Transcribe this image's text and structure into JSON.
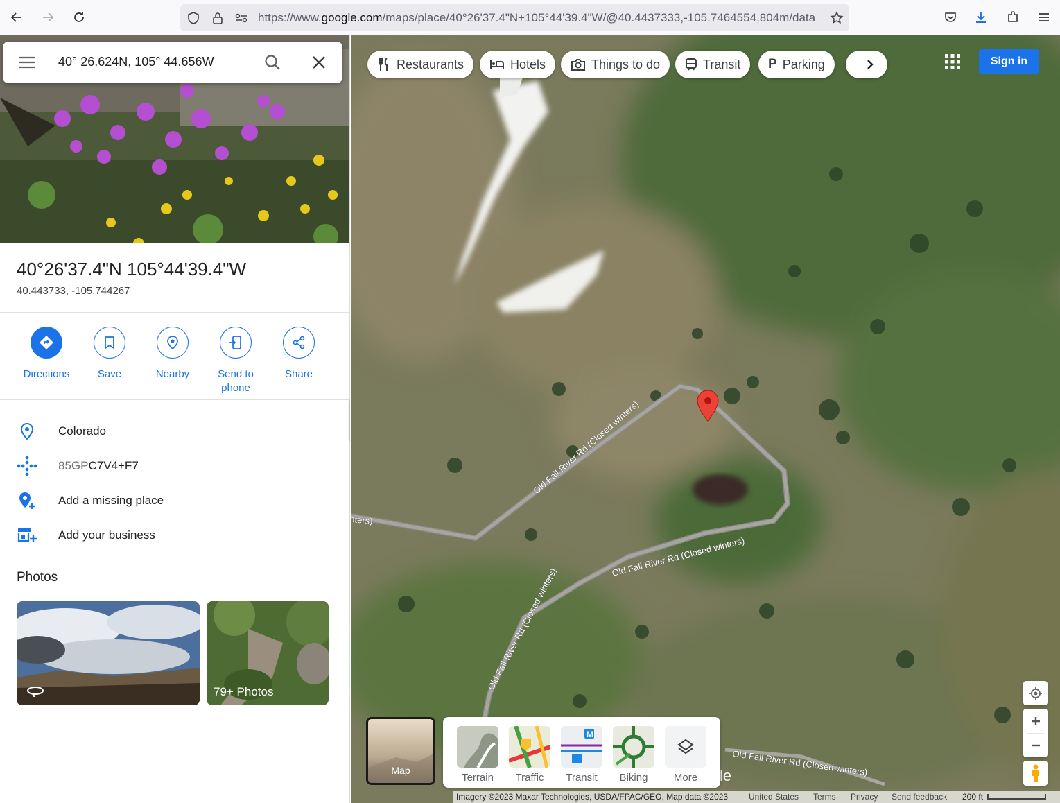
{
  "browser": {
    "url_prefix": "https://www.",
    "url_domain": "google.com",
    "url_rest": "/maps/place/40°26'37.4\"N+105°44'39.4\"W/@40.4437333,-105.7464554,804m/data"
  },
  "search": {
    "value": "40° 26.624N, 105° 44.656W"
  },
  "place": {
    "title": "40°26'37.4\"N 105°44'39.4\"W",
    "coords": "40.443733, -105.744267"
  },
  "actions": [
    {
      "label": "Directions"
    },
    {
      "label": "Save"
    },
    {
      "label": "Nearby"
    },
    {
      "label": "Send to phone"
    },
    {
      "label": "Share"
    }
  ],
  "info": {
    "region": "Colorado",
    "plus_code_prefix": "85GP",
    "plus_code_main": "C7V4+F7",
    "add_missing": "Add a missing place",
    "add_business": "Add your business"
  },
  "photos": {
    "heading": "Photos",
    "more_label": "79+ Photos"
  },
  "chips": [
    "Restaurants",
    "Hotels",
    "Things to do",
    "Transit",
    "Parking"
  ],
  "sign_in": "Sign in",
  "layers": {
    "map_label": "Map",
    "items": [
      "Terrain",
      "Traffic",
      "Transit",
      "Biking",
      "More"
    ]
  },
  "road_labels": {
    "road1": "Old Fall River Rd (Closed winters)",
    "road_edge": "nters)",
    "watermark": "le"
  },
  "attribution": {
    "imagery": "Imagery ©2023 Maxar Technologies, USDA/FPAC/GEO, Map data ©2023",
    "country": "United States",
    "terms": "Terms",
    "privacy": "Privacy",
    "feedback": "Send feedback",
    "scale": "200 ft"
  },
  "colors": {
    "accent": "#1a73e8",
    "pin": "#ea4335",
    "chip_text": "#3c4043"
  }
}
